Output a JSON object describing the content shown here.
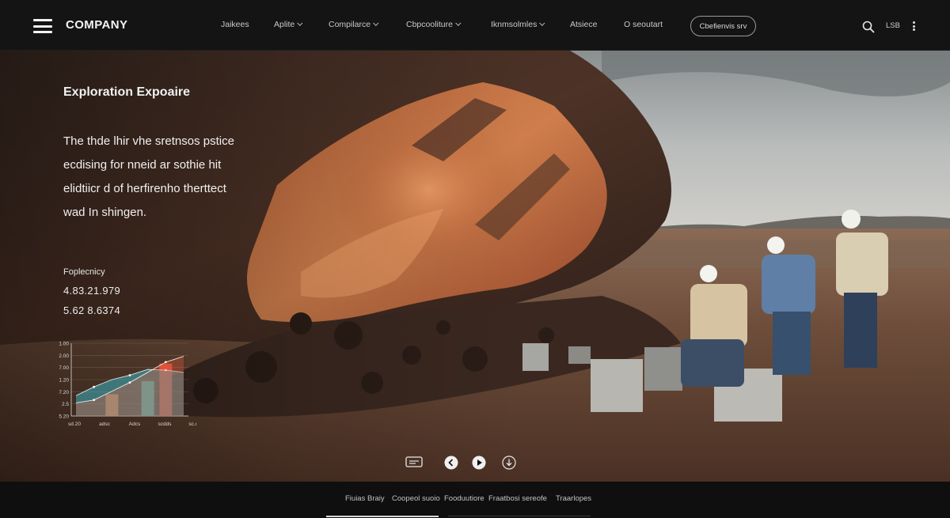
{
  "brand": {
    "name": "COMPANY"
  },
  "nav": {
    "items": [
      {
        "label": "Jaikees",
        "dropdown": false
      },
      {
        "label": "Aplite",
        "dropdown": true
      },
      {
        "label": "Compilarce",
        "dropdown": true
      },
      {
        "label": "Cbpcooliture",
        "dropdown": true
      },
      {
        "label": "Iknmsolmles",
        "dropdown": true
      },
      {
        "label": "Atsiece",
        "dropdown": false
      },
      {
        "label": "O seoutart",
        "dropdown": false
      }
    ],
    "cta_label": "Cbefienvis srv",
    "lang": "LSB",
    "icons": {
      "menu": "hamburger-icon",
      "search": "search-icon",
      "more": "kebab-icon"
    }
  },
  "hero": {
    "eyebrow": "Exploration Expoaire",
    "body_lines": [
      "The thde lhir vhe sretnsos pstice",
      "ecdising for nneid ar sothie hit",
      "elidtiicr d of herfirenho therttect",
      "wad In shingen."
    ],
    "stat_label": "Foplecnicy",
    "stat_values": [
      "4.83.21.979",
      "5.62 8.6374"
    ]
  },
  "chart_data": {
    "type": "area",
    "title": "",
    "yticks": [
      "1.00",
      "2.00",
      "7.00",
      "1.20",
      "7.20",
      "2.5",
      "5.20"
    ],
    "xticks": [
      "sd.20",
      "adsc",
      "Adcs",
      "scdds",
      "sc.ds"
    ],
    "series": [
      {
        "color": "#3ab0c0",
        "values": [
          0.28,
          0.4,
          0.5,
          0.56,
          0.64,
          0.63,
          0.6
        ]
      },
      {
        "color": "#e85a3a",
        "values": [
          0.18,
          0.22,
          0.34,
          0.46,
          0.6,
          0.74,
          0.82
        ]
      }
    ],
    "bars": [
      {
        "x": 2,
        "value": 0.3,
        "color": "#f09050"
      },
      {
        "x": 4,
        "value": 0.48,
        "color": "#5ac0b0"
      },
      {
        "x": 5,
        "value": 0.72,
        "color": "#e6503a"
      }
    ],
    "ylim": [
      0,
      1
    ],
    "grid": true
  },
  "hero_controls": [
    {
      "icon": "caption-icon"
    },
    {
      "icon": "chevron-left-icon"
    },
    {
      "icon": "play-icon"
    },
    {
      "icon": "download-icon"
    }
  ],
  "footer": {
    "items": [
      "Fiuias Braiy",
      "Coopeol suoio",
      "Fooduutiore",
      "Fraatbosi sereofe",
      "Traarlopes"
    ]
  }
}
